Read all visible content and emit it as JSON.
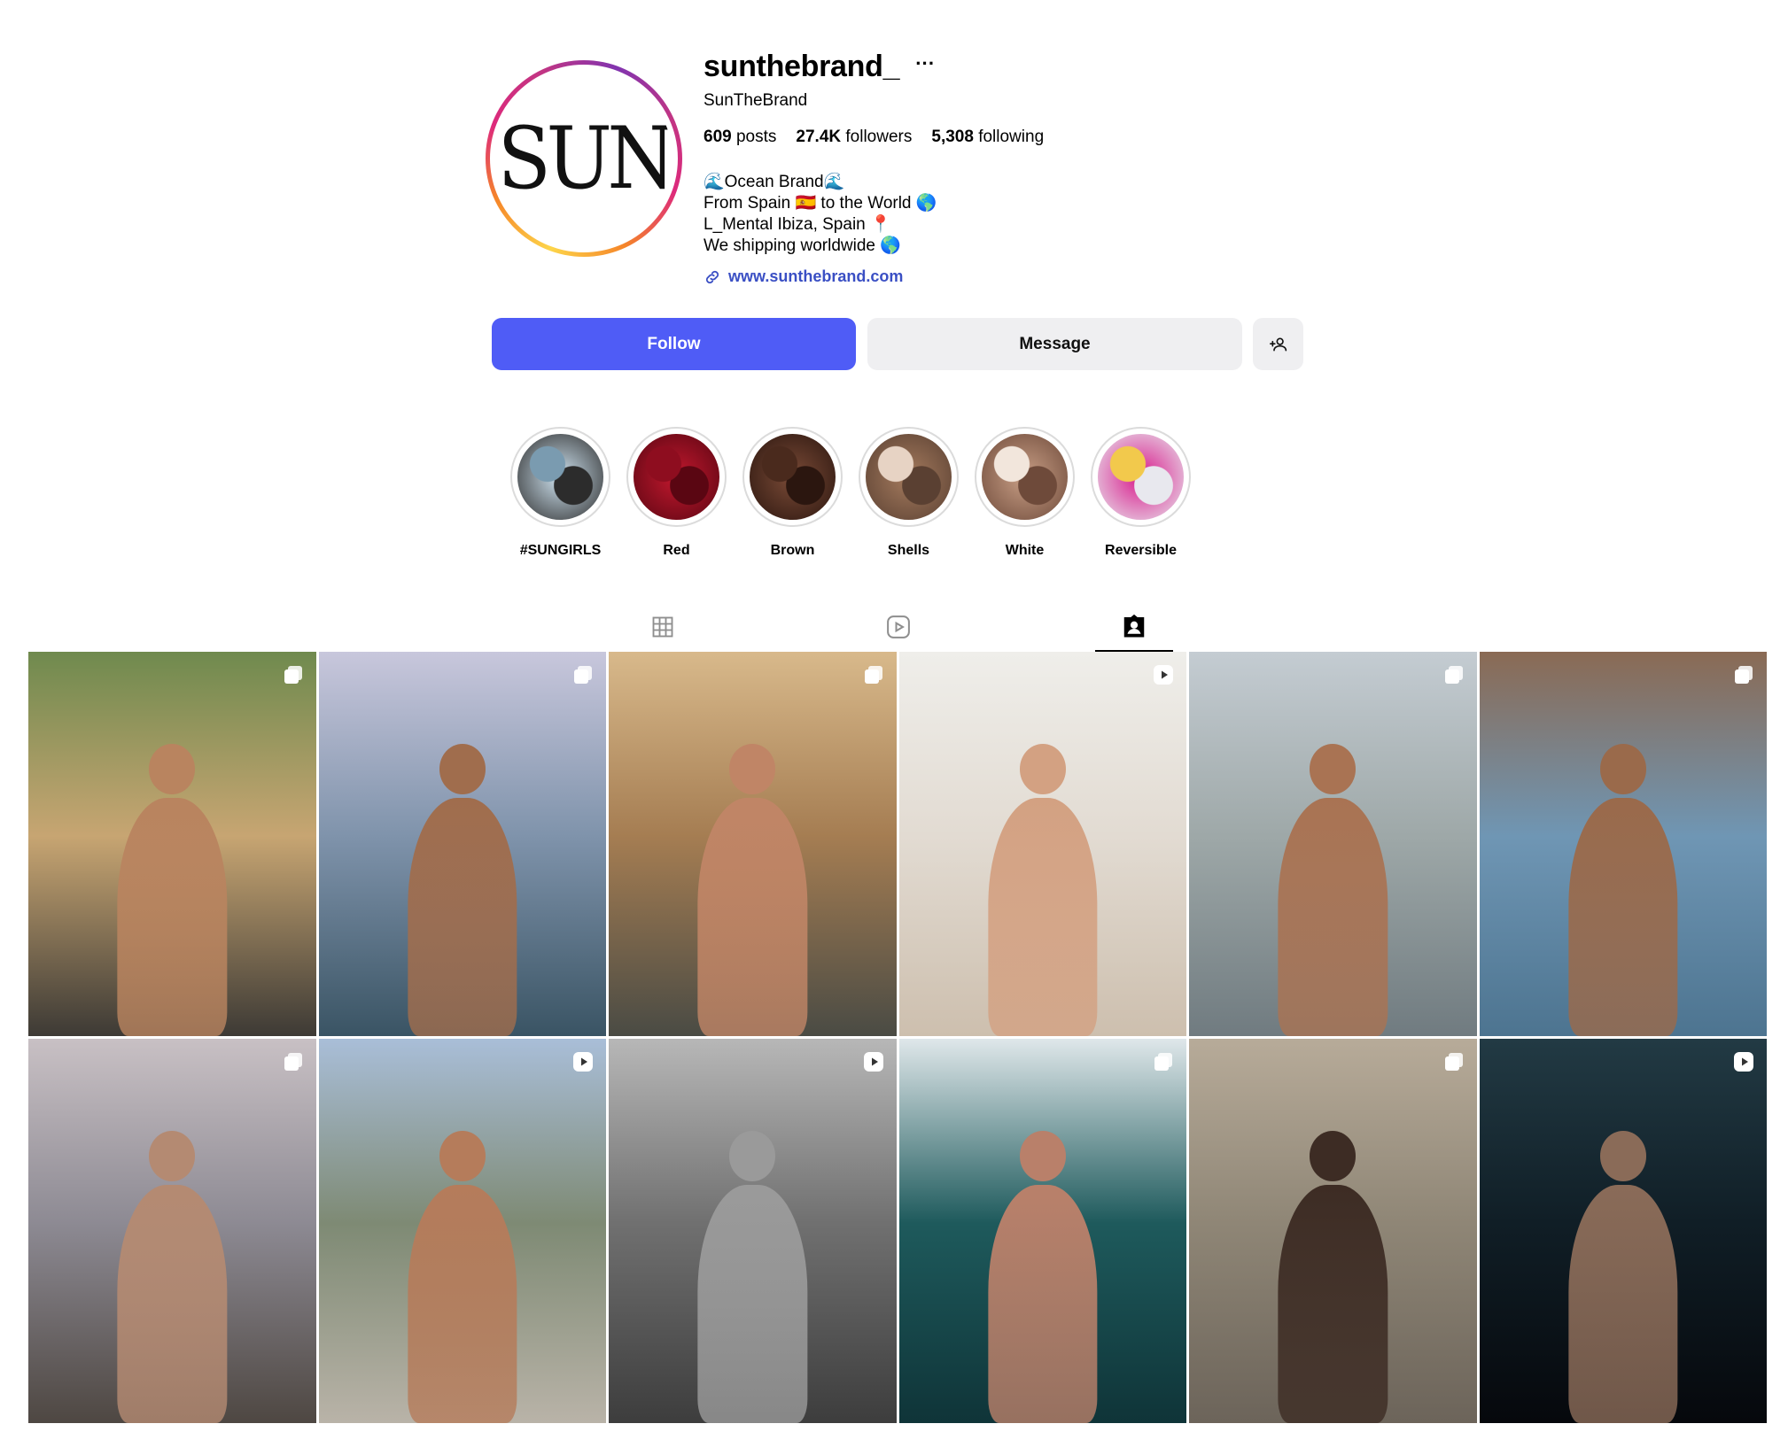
{
  "profile": {
    "username": "sunthebrand_",
    "more_glyph": "···",
    "full_name": "SunTheBrand",
    "avatar_text": "SUN",
    "stats": [
      {
        "value": "609",
        "label": "posts"
      },
      {
        "value": "27.4K",
        "label": "followers"
      },
      {
        "value": "5,308",
        "label": "following"
      }
    ],
    "bio": [
      "🌊Ocean Brand🌊",
      "From Spain 🇪🇸 to the World 🌎",
      "L_Mental Ibiza, Spain 📍",
      "We shipping worldwide 🌎"
    ],
    "website": "www.sunthebrand.com"
  },
  "actions": {
    "follow_label": "Follow",
    "message_label": "Message",
    "suggest_icon": "add-person-icon"
  },
  "highlights": [
    {
      "label": "#SUNGIRLS",
      "colors": [
        "#cfe3f0",
        "#7a9bb0",
        "#2c2c2c"
      ]
    },
    {
      "label": "Red",
      "colors": [
        "#c2182e",
        "#8e0d1f",
        "#5a0612"
      ]
    },
    {
      "label": "Brown",
      "colors": [
        "#7b4b37",
        "#4a2a1d",
        "#2b160f"
      ]
    },
    {
      "label": "Shells",
      "colors": [
        "#a57b5e",
        "#e7d3c4",
        "#5a4032"
      ]
    },
    {
      "label": "White",
      "colors": [
        "#c99f86",
        "#f2e6dc",
        "#6e4a3a"
      ]
    },
    {
      "label": "Reversible",
      "colors": [
        "#d8198b",
        "#f2c94c",
        "#e8e8ee"
      ]
    }
  ],
  "tabs": [
    {
      "name": "posts",
      "icon": "grid-icon",
      "active": false
    },
    {
      "name": "reels",
      "icon": "reels-icon",
      "active": false
    },
    {
      "name": "tagged",
      "icon": "tagged-icon",
      "active": true
    }
  ],
  "posts": [
    {
      "badge": "carousel-icon",
      "bg": [
        "#6f8a4e",
        "#c7a572",
        "#3d3a35"
      ],
      "skin": "#b9845f"
    },
    {
      "badge": "carousel-icon",
      "bg": [
        "#c8c7dc",
        "#7f93ab",
        "#3a5464"
      ],
      "skin": "#a06d4d"
    },
    {
      "badge": "carousel-icon",
      "bg": [
        "#d8b98b",
        "#a57d52",
        "#4a4b44"
      ],
      "skin": "#c08566"
    },
    {
      "badge": "reel-icon",
      "bg": [
        "#efeeea",
        "#e2dbd2",
        "#cdbfae"
      ],
      "skin": "#d3a182"
    },
    {
      "badge": "carousel-icon",
      "bg": [
        "#c4ccd2",
        "#9ea8a8",
        "#707b80"
      ],
      "skin": "#a97353"
    },
    {
      "badge": "carousel-icon",
      "bg": [
        "#8a6a54",
        "#6f96b4",
        "#4d7490"
      ],
      "skin": "#9a6a4b"
    },
    {
      "badge": "carousel-icon",
      "bg": [
        "#c8c0c4",
        "#8d8a93",
        "#4e4742"
      ],
      "skin": "#b48a72"
    },
    {
      "badge": "reel-icon",
      "bg": [
        "#a9bed8",
        "#7e8a74",
        "#b9b3a8"
      ],
      "skin": "#b57c5b"
    },
    {
      "badge": "reel-icon",
      "bg": [
        "#b7b7b7",
        "#707070",
        "#3d3d3d"
      ],
      "skin": "#9a9a9a"
    },
    {
      "badge": "carousel-icon",
      "bg": [
        "#dfe7ea",
        "#1e5a5c",
        "#0f3438"
      ],
      "skin": "#b9806a"
    },
    {
      "badge": "carousel-icon",
      "bg": [
        "#b7ab99",
        "#8f8676",
        "#6c645a"
      ],
      "skin": "#3d2c24"
    },
    {
      "badge": "reel-icon",
      "bg": [
        "#223a44",
        "#101e26",
        "#06080c"
      ],
      "skin": "#8a6b58"
    }
  ]
}
